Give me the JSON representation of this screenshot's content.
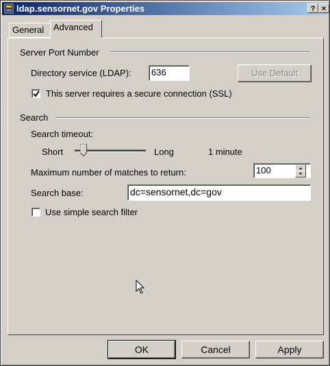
{
  "window": {
    "title": "ldap.sensornet.gov Properties",
    "help_glyph": "?",
    "close_glyph": "×"
  },
  "tabs": [
    {
      "label": "General",
      "active": false
    },
    {
      "label": "Advanced",
      "active": true
    }
  ],
  "server_port": {
    "group_label": "Server Port Number",
    "ldap_label": "Directory service (LDAP):",
    "ldap_value": "636",
    "use_default_label": "Use Default",
    "ssl_label": "This server requires a secure connection (SSL)",
    "ssl_checked": true
  },
  "search": {
    "group_label": "Search",
    "timeout_label": "Search timeout:",
    "short_label": "Short",
    "long_label": "Long",
    "timeout_value": "1 minute",
    "timeout_level": 0.1,
    "max_matches_label": "Maximum number of matches to return:",
    "max_matches_value": "100",
    "base_label": "Search base:",
    "base_value": "dc=sensornet,dc=gov",
    "simple_filter_label": "Use simple search filter",
    "simple_filter_checked": false
  },
  "buttons": {
    "ok": "OK",
    "cancel": "Cancel",
    "apply": "Apply"
  },
  "icons": [
    "app-icon",
    "help-icon",
    "close-icon",
    "check-icon",
    "spin-up-icon",
    "spin-down-icon",
    "mouse-cursor-icon"
  ]
}
